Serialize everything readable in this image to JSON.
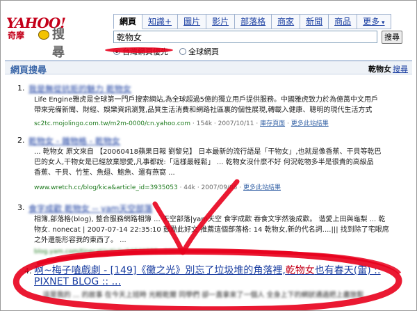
{
  "logo": {
    "brand": "YAHOO!",
    "sub": "奇摩",
    "search": "搜尋"
  },
  "tabs": [
    {
      "label": "網頁",
      "active": true
    },
    {
      "label": "知識+",
      "active": false
    },
    {
      "label": "圖片",
      "active": false
    },
    {
      "label": "影片",
      "active": false
    },
    {
      "label": "部落格",
      "active": false
    },
    {
      "label": "商家",
      "active": false
    },
    {
      "label": "新聞",
      "active": false
    },
    {
      "label": "商品",
      "active": false
    },
    {
      "label": "更多",
      "active": false
    }
  ],
  "search": {
    "query": "乾物女",
    "button": "搜尋"
  },
  "scope": {
    "option_taiwan": "台灣網頁優先",
    "option_global": "全球網頁"
  },
  "section": {
    "title": "網頁搜尋",
    "query": "乾物女",
    "suffix": "搜尋"
  },
  "results": [
    {
      "num": "1.",
      "title": "我是無從抗拒的魅力 乾物女",
      "lines": [
        "Life Engine雅虎是全球第一門戶搜索網站,為全球超過5億的獨立用戶提供服務。中國雅虎致力於為億萬中文用戶",
        "帶來完備新聞、財經、娛樂資訊瀏覽,品質生活消費和網路社區裏的個性展現,轉載入健康、聰明的現代生活方式"
      ],
      "url": "sc2tc.mojolingo.com.tw/m2m-0000/cn.yahoo.com",
      "meta": " · 154k · 2007/10/11 · ",
      "cache": "庫存頁面",
      "more": "更多此站結果"
    },
    {
      "num": "2.",
      "title": "乾物女 - 雜物格 - 乾物女",
      "lines": [
        "... 乾物女 原文來自 【20060418蘋果日報 劉黎兒】 日本最新的流行語是「干物女」,也就是像香蕉、干貝等乾巴",
        "巴的女人,干物女是已經放棄戀愛,凡事都說:「這樣最輕鬆」 ... 乾物女沒什麼不好 何況乾物多半是很貴的高級品",
        "香蕉、干貝、竹笙、魚翅、鮑魚、還有燕窩 ..."
      ],
      "url": "www.wretch.cc/blog/kica&article_id=3935053",
      "meta": " · 44k · 2007/09/05 · ",
      "more": "更多此站結果"
    },
    {
      "num": "3.",
      "title": "食字成歡 乾物女 -- yam天空部落",
      "lines": [
        "相簿,部落格(blog), 整合服務網路相簿 ... 天空部落|yam天空 食字成歡 吞食文字然後成歡。 谐愛上田與龜梨 ... 乾",
        "物女. nonecat | 2007-07-14 22:35:10 鼓勵此好文 推薦這個部落格: 14 乾物女,新的代名詞....||| 找到除了宅眼席",
        "之外還能形容我的東西了。 ..."
      ],
      "url": "blog.yam.com/tinecat/article/10536555",
      "meta": " · 2007/07 · "
    }
  ],
  "result4": {
    "num": "4.",
    "title_before": "啊~梅子嗑戲劇 - [149]《黴之光》別忘了垃圾堆的角落裡,",
    "title_hl": "乾物女",
    "title_after": "也有春天(雷) :: PIXNET BLOG :: ...",
    "line": "... 這是我的 ... 的故事 在今天上班時 光輕乾爾 同學們 卻一直拿來了一個人 全身上下的網狀通過把上盡放鬆 ..."
  }
}
